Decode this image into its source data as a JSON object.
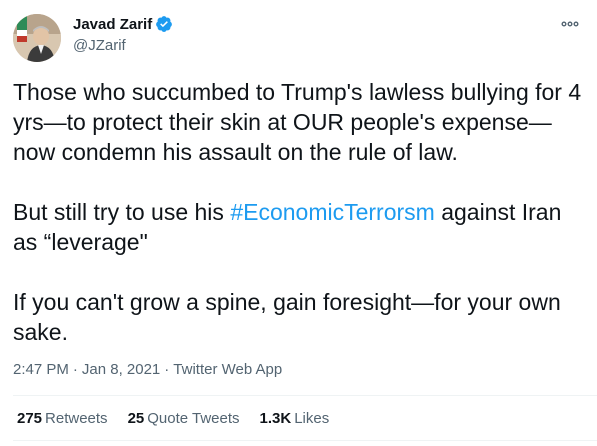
{
  "author": {
    "display_name": "Javad Zarif",
    "handle": "@JZarif",
    "verified_icon": "verified-badge-icon",
    "more_icon": "more-options-icon"
  },
  "tweet": {
    "paragraph1": "Those who succumbed to Trump's lawless bullying for 4 yrs—to protect their skin at OUR people's expense—now condemn his assault on the rule of law.",
    "paragraph2_before": "But still try to use his ",
    "hashtag": "#EconomicTerrorsm",
    "paragraph2_after": " against Iran as “leverage\"",
    "paragraph3": "If you can't grow a spine, gain foresight—for your own sake."
  },
  "meta": {
    "time": "2:47 PM",
    "separator1": "·",
    "date": "Jan 8, 2021",
    "separator2": "·",
    "source": "Twitter Web App"
  },
  "stats": {
    "retweets_count": "275",
    "retweets_label": "Retweets",
    "quotes_count": "25",
    "quotes_label": "Quote Tweets",
    "likes_count": "1.3K",
    "likes_label": "Likes"
  },
  "colors": {
    "accent": "#1d9bf0",
    "secondary_text": "#536471",
    "divider": "#eff3f4"
  }
}
